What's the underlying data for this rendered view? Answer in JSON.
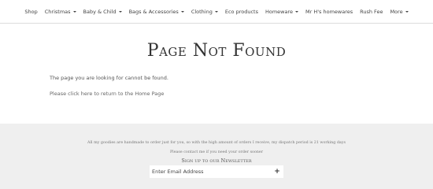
{
  "nav": {
    "items": [
      {
        "label": "Shop",
        "dropdown": false
      },
      {
        "label": "Christmas",
        "dropdown": true
      },
      {
        "label": "Baby & Child",
        "dropdown": true
      },
      {
        "label": "Bags & Accessories",
        "dropdown": true
      },
      {
        "label": "Clothing",
        "dropdown": true
      },
      {
        "label": "Eco products",
        "dropdown": false
      },
      {
        "label": "Homeware",
        "dropdown": true
      },
      {
        "label": "Mr H's homewares",
        "dropdown": false
      },
      {
        "label": "Rush Fee",
        "dropdown": false
      },
      {
        "label": "More",
        "dropdown": true
      }
    ]
  },
  "main": {
    "title": "Page Not Found",
    "message": "The page you are looking for cannot be found.",
    "home_link": "Please click here to return to the Home Page"
  },
  "footer": {
    "notice": "All my goodies are handmade to order just for you, so with the high amount of orders I receive, my dispatch period is 21 working days",
    "contact": "Please contact me if you need your order sooner",
    "signup_title": "Sign up to our Newsletter",
    "email_placeholder": "Enter Email Address",
    "submit_icon": "plus-icon"
  }
}
